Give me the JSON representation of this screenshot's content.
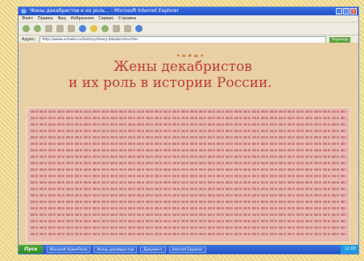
{
  "window": {
    "title": "Жены декабристов и их роль... - Microsoft Internet Explorer",
    "buttons": [
      "_",
      "□",
      "×"
    ]
  },
  "menubar": {
    "items": [
      "Файл",
      "Правка",
      "Вид",
      "Избранное",
      "Сервис",
      "Справка"
    ]
  },
  "addressbar": {
    "label": "Адрес:",
    "url": "http://www.ucheba.ru/history/zheny-dekabristov.htm",
    "go_label": "Переход"
  },
  "page": {
    "ornament": "•❧✦☙•",
    "title_line1": "Жены декабристов",
    "title_line2": "и их роль в истории России."
  },
  "taskbar": {
    "start_label": "Пуск",
    "tasks": [
      "Microsoft PowerPoint",
      "Жены декабристов",
      "Документ",
      "Internet Explorer"
    ],
    "clock": "12:00"
  },
  "colors": {
    "title": "#c23d2c",
    "page_bg": "#e9cfa5",
    "text_box": "#eab9b2",
    "frame": "#f6e6ae"
  }
}
